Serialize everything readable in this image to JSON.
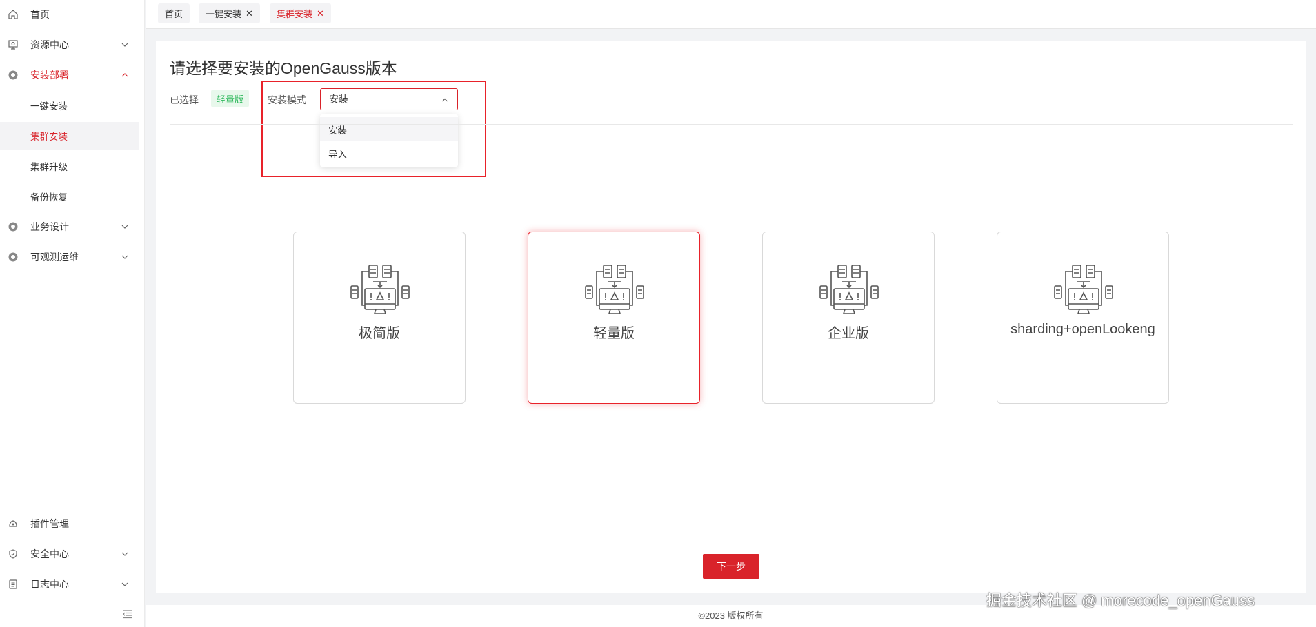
{
  "sidebar": {
    "items": [
      {
        "label": "首页",
        "icon": "home-icon",
        "expandable": false
      },
      {
        "label": "资源中心",
        "icon": "resource-icon",
        "expandable": true
      },
      {
        "label": "安装部署",
        "icon": "gear-icon",
        "expandable": true,
        "expanded": true,
        "children": [
          "一键安装",
          "集群安装",
          "集群升级",
          "备份恢复"
        ],
        "selected_child": "集群安装"
      },
      {
        "label": "业务设计",
        "icon": "gear-icon",
        "expandable": true
      },
      {
        "label": "可观测运维",
        "icon": "gear-icon",
        "expandable": true
      }
    ],
    "bottom_items": [
      {
        "label": "插件管理",
        "icon": "plugin-icon",
        "expandable": false
      },
      {
        "label": "安全中心",
        "icon": "shield-icon",
        "expandable": true
      },
      {
        "label": "日志中心",
        "icon": "document-icon",
        "expandable": true
      }
    ]
  },
  "tabs": [
    {
      "label": "首页",
      "closable": false,
      "active": false
    },
    {
      "label": "一键安装",
      "closable": true,
      "active": false
    },
    {
      "label": "集群安装",
      "closable": true,
      "active": true
    }
  ],
  "main": {
    "heading": "请选择要安装的OpenGauss版本",
    "selected_label": "已选择",
    "selected_value": "轻量版",
    "mode_label": "安装模式",
    "mode_value": "安装",
    "mode_options": [
      "安装",
      "导入"
    ],
    "versions": [
      "极简版",
      "轻量版",
      "企业版",
      "sharding+openLookeng"
    ],
    "selected_version": "轻量版",
    "next_button": "下一步"
  },
  "footer": "©2023 版权所有",
  "watermark": "掘金技术社区 @ morecode_openGauss",
  "colors": {
    "accent": "#d9232a",
    "success": "#2eb85c"
  }
}
